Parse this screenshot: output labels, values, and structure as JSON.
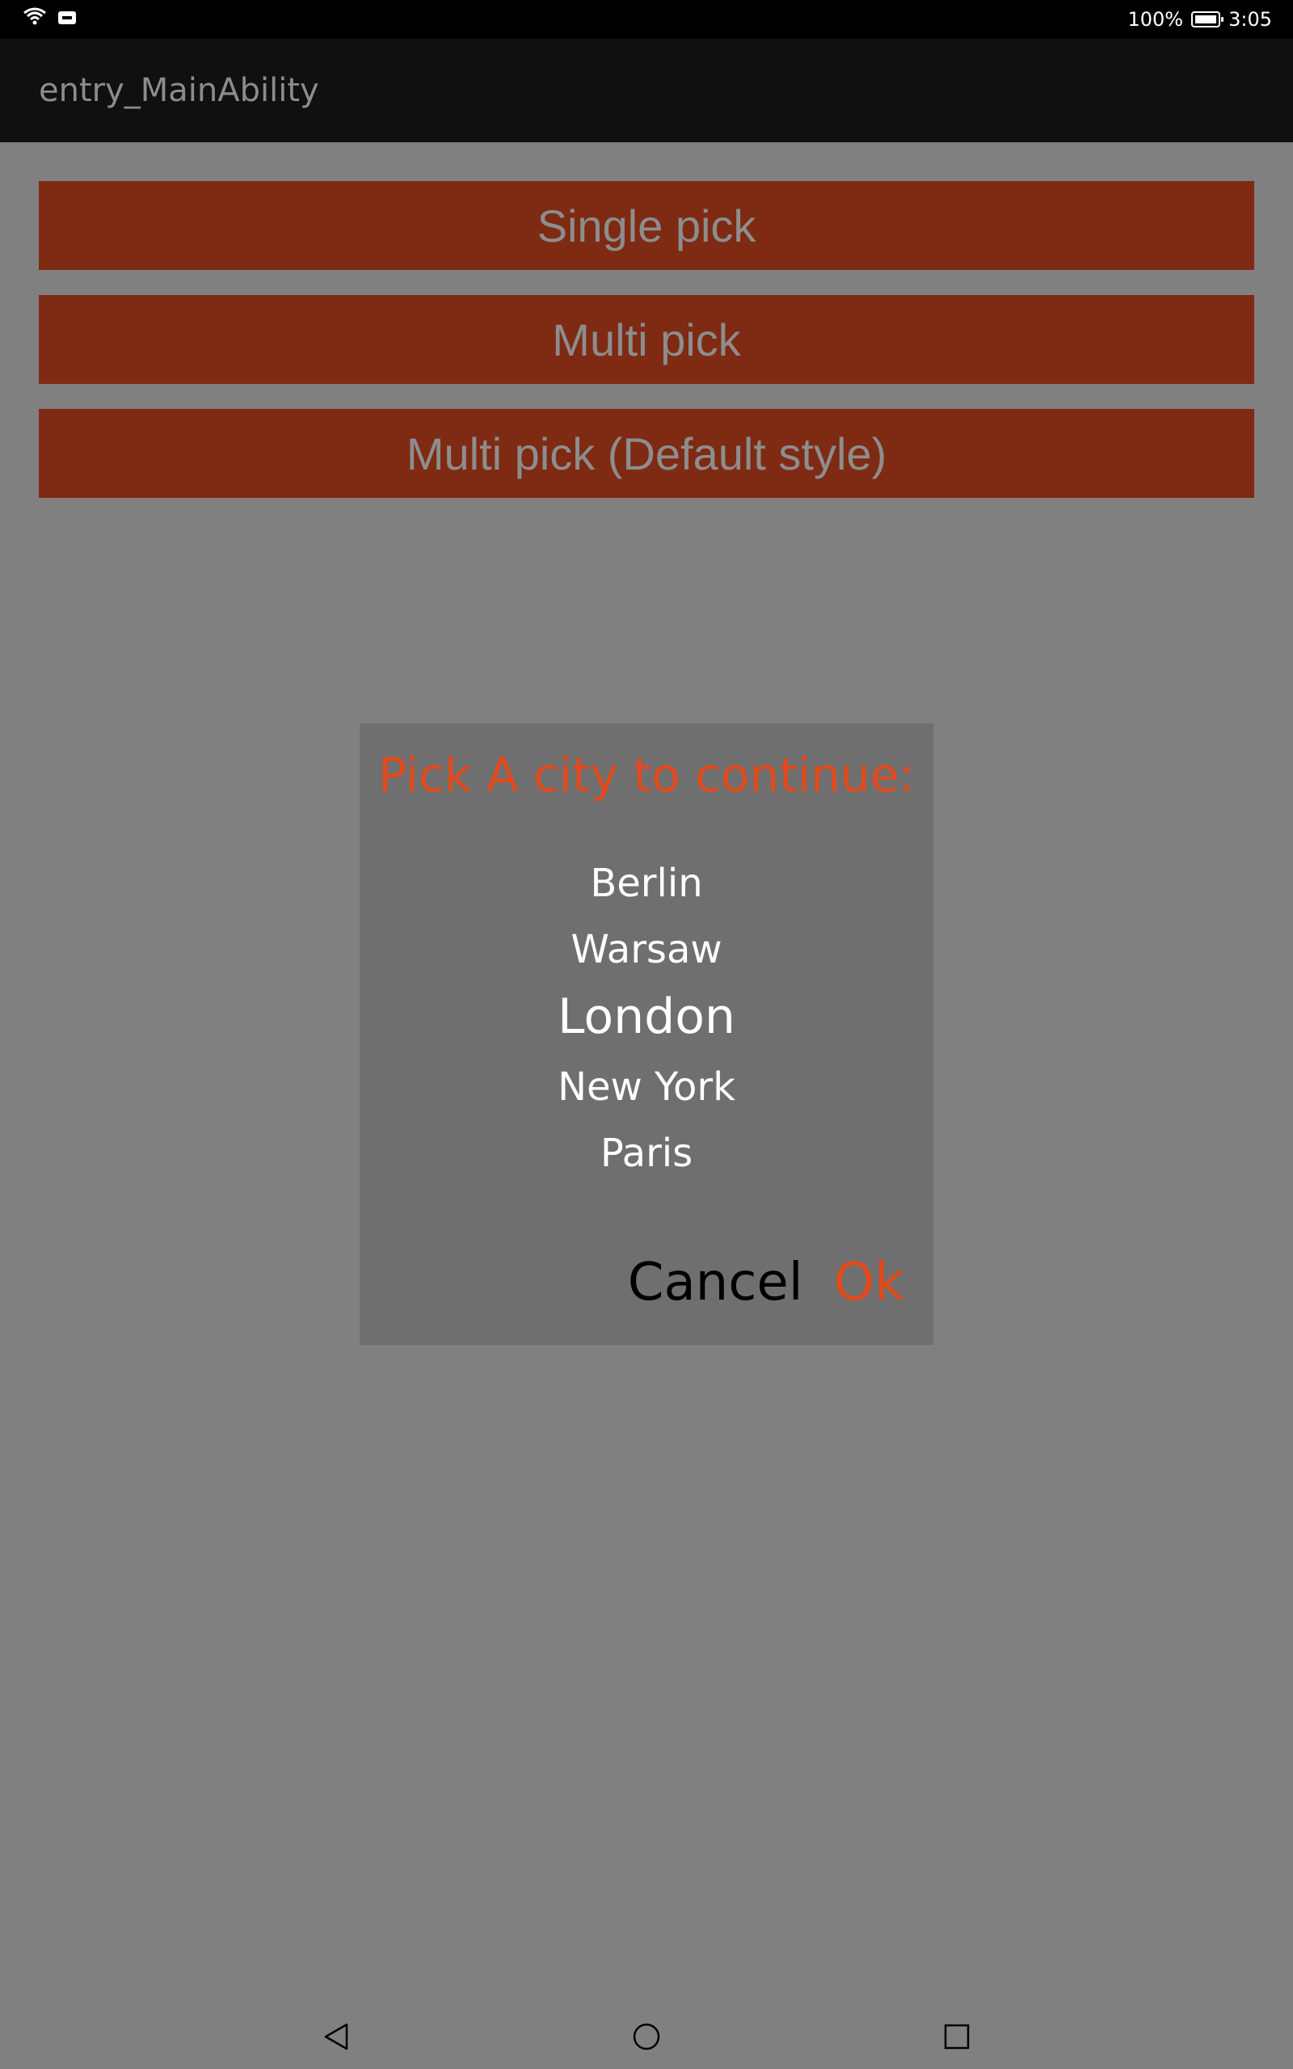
{
  "status_bar": {
    "icons": [
      "wifi-icon",
      "nfc-icon",
      "battery-icon"
    ],
    "battery_text": "100%",
    "time": "3:05"
  },
  "app_bar": {
    "title": "entry_MainAbility"
  },
  "buttons": {
    "single_pick": "Single pick",
    "multi_pick": "Multi pick",
    "multi_pick_default": "Multi pick (Default style)"
  },
  "dialog": {
    "title": "Pick A city to continue:",
    "cities": [
      "Berlin",
      "Warsaw",
      "London",
      "New York",
      "Paris"
    ],
    "selected_city": "London",
    "cancel_label": "Cancel",
    "ok_label": "Ok"
  },
  "nav_bar": {
    "icons": [
      "back-icon",
      "home-icon",
      "recents-icon"
    ]
  },
  "colors": {
    "accent": "#e14a1c",
    "button_bg": "#7f2a13",
    "scrim": "#808080",
    "dialog_bg": "#6f6f6f"
  }
}
